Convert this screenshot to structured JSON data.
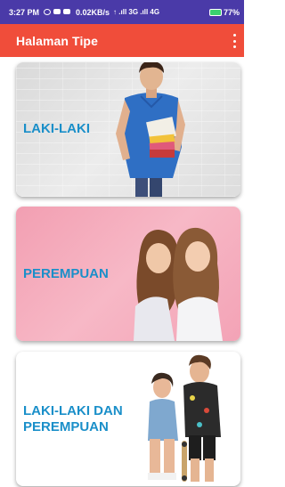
{
  "status_bar": {
    "time": "3:27 PM",
    "network_speed": "0.02KB/s",
    "signal_text": "↑ .ıll 3G .ıll 4G",
    "battery": "77%"
  },
  "app_bar": {
    "title": "Halaman Tipe",
    "menu_icon": "more-vert-icon"
  },
  "cards": [
    {
      "label": "LAKI-LAKI",
      "photo": "boy-with-books"
    },
    {
      "label": "PEREMPUAN",
      "photo": "two-girls"
    },
    {
      "label": "LAKI-LAKI DAN PEREMPUAN",
      "photo": "boy-and-girl"
    }
  ],
  "colors": {
    "status_bar": "#4a3aa8",
    "app_bar": "#f04d3a",
    "label": "#1a8fc9",
    "card2_bg": "#f3a9ba"
  }
}
